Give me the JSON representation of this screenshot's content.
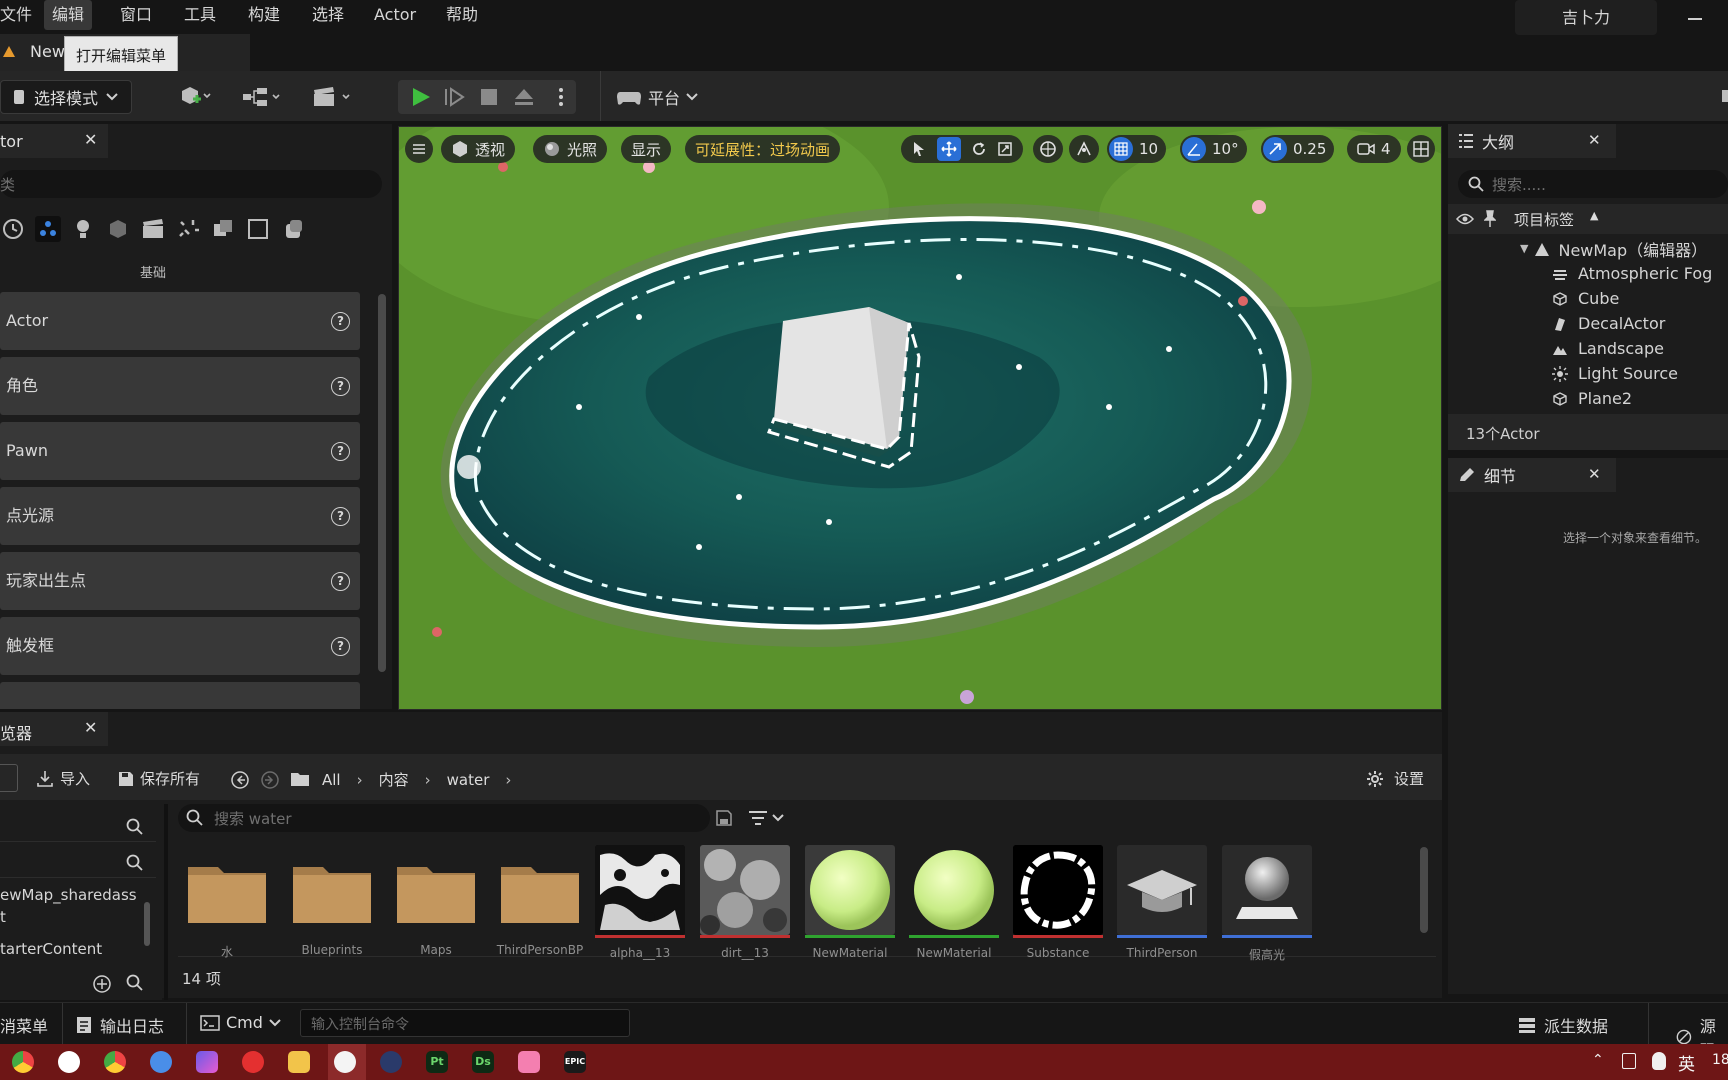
{
  "menu": {
    "items": [
      {
        "label": "文件"
      },
      {
        "label": "编辑"
      },
      {
        "label": "窗口"
      },
      {
        "label": "工具"
      },
      {
        "label": "构建"
      },
      {
        "label": "选择"
      },
      {
        "label": "Actor"
      },
      {
        "label": "帮助"
      }
    ],
    "active_index": 1,
    "user": "吉卜力"
  },
  "tab": {
    "title": "New",
    "tooltip": "打开编辑菜单"
  },
  "toolbar": {
    "mode_label": "选择模式",
    "platform_label": "平台"
  },
  "place_actors": {
    "tab_title": "tor",
    "search_placeholder": "类",
    "category_label": "基础",
    "items": [
      {
        "label": "Actor"
      },
      {
        "label": "角色"
      },
      {
        "label": "Pawn"
      },
      {
        "label": "点光源"
      },
      {
        "label": "玩家出生点"
      },
      {
        "label": "触发框"
      }
    ]
  },
  "viewport": {
    "perspective_label": "透视",
    "lit_label": "光照",
    "show_label": "显示",
    "scalability_label": "可延展性：过场动画",
    "grid_snap": "10",
    "rotation_snap": "10°",
    "scale_snap": "0.25",
    "camera_speed": "4"
  },
  "outliner": {
    "title": "大纲",
    "search_placeholder": "搜索.....",
    "column_label": "项目标签",
    "root": "NewMap（编辑器）",
    "items": [
      {
        "label": "Atmospheric Fog",
        "icon": "fog-icon"
      },
      {
        "label": "Cube",
        "icon": "static-mesh-icon"
      },
      {
        "label": "DecalActor",
        "icon": "decal-icon"
      },
      {
        "label": "Landscape",
        "icon": "landscape-icon"
      },
      {
        "label": "Light Source",
        "icon": "sun-icon"
      },
      {
        "label": "Plane2",
        "icon": "static-mesh-icon"
      }
    ],
    "count": "13个Actor"
  },
  "details": {
    "title": "细节",
    "empty_message": "选择一个对象来查看细节。"
  },
  "content_browser": {
    "tab_title": "览器",
    "import_label": "导入",
    "save_all_label": "保存所有",
    "breadcrumb": [
      "All",
      "内容",
      "water"
    ],
    "settings_label": "设置",
    "search_placeholder": "搜索 water",
    "sources": [
      "ewMap_sharedass",
      "t",
      "tarterContent"
    ],
    "item_count": "14 项",
    "assets": [
      {
        "name": "水",
        "kind": "folder",
        "bar_color": ""
      },
      {
        "name": "Blueprints",
        "kind": "folder",
        "bar_color": ""
      },
      {
        "name": "Maps",
        "kind": "folder",
        "bar_color": ""
      },
      {
        "name": "ThirdPersonBP",
        "kind": "folder",
        "bar_color": ""
      },
      {
        "name": "alpha__13",
        "kind": "texture-alpha",
        "bar_color": "#c03030"
      },
      {
        "name": "dirt__13",
        "kind": "texture-dirt",
        "bar_color": "#c03030"
      },
      {
        "name": "NewMaterial",
        "kind": "material",
        "bar_color": "#2fa32f"
      },
      {
        "name": "NewMaterial",
        "kind": "material",
        "bar_color": "#2fa32f"
      },
      {
        "name": "Substance",
        "kind": "texture-ring",
        "bar_color": "#c03030"
      },
      {
        "name": "ThirdPerson",
        "kind": "cap",
        "bar_color": "#3f6fd6"
      },
      {
        "name": "假高光",
        "kind": "sphere-gray",
        "bar_color": "#3f6fd6"
      }
    ]
  },
  "statusbar": {
    "drawer_label": "消菜单",
    "output_log_label": "输出日志",
    "cmd_label": "Cmd",
    "console_placeholder": "输入控制台命令",
    "derived_data_label": "派生数据",
    "source_control_label": "源码"
  },
  "taskbar": {
    "ime": "英",
    "clock": "18"
  }
}
